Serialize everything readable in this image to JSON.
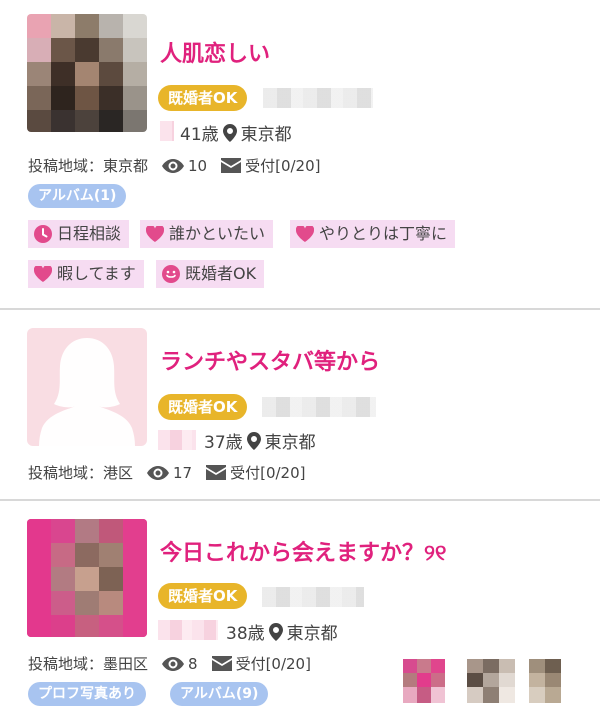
{
  "posts": [
    {
      "title": "人肌恋しい",
      "badge": "既婚者OK",
      "age": "41歳",
      "location": "東京都",
      "area": "投稿地域：東京都",
      "views": "10",
      "reception": "受付[0/20]",
      "album": "アルバム(1)",
      "tags": [
        {
          "icon": "clock-icon",
          "label": "日程相談"
        },
        {
          "icon": "heart-icon",
          "label": "誰かといたい"
        },
        {
          "icon": "heart-icon",
          "label": "やりとりは丁寧に"
        },
        {
          "icon": "heart-icon",
          "label": "暇してます"
        },
        {
          "icon": "smile-icon",
          "label": "既婚者OK"
        }
      ]
    },
    {
      "title": "ランチやスタバ等から",
      "badge": "既婚者OK",
      "age": "37歳",
      "location": "東京都",
      "area": "投稿地域：港区",
      "views": "17",
      "reception": "受付[0/20]"
    },
    {
      "title": "今日これから会えますか？୨୧",
      "badge": "既婚者OK",
      "age": "38歳",
      "location": "東京都",
      "area": "投稿地域：墨田区",
      "views": "8",
      "reception": "受付[0/20]",
      "photo_chip": "プロフ写真あり",
      "album": "アルバム(9)"
    }
  ],
  "colors": {
    "title": "#e0217d",
    "badge": "#e8b52a",
    "chip": "#a8c4f0",
    "tag_bg": "#f6dcf2",
    "icon_pink": "#e24a8c"
  }
}
